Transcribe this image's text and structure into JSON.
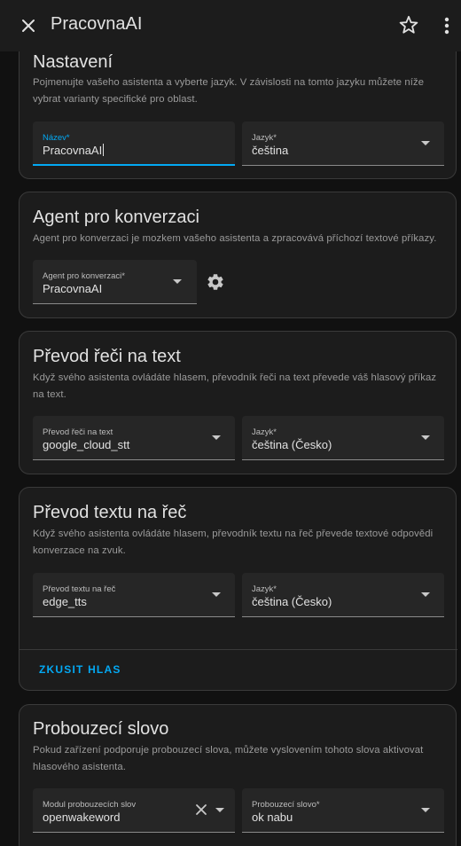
{
  "header": {
    "title": "PracovnaAI",
    "close_icon": "close-icon",
    "star_icon": "star-outline-icon",
    "more_icon": "more-vertical-icon"
  },
  "settings": {
    "title": "Nastavení",
    "description": "Pojmenujte vašeho asistenta a vyberte jazyk. V závislosti na tomto jazyku můžete níže vybrat varianty specifické pro oblast.",
    "name_label": "Název*",
    "name_value": "PracovnaAI",
    "language_label": "Jazyk*",
    "language_value": "čeština"
  },
  "conversation": {
    "title": "Agent pro konverzaci",
    "description": "Agent pro konverzaci je mozkem vašeho asistenta a zpracovává příchozí textové příkazy.",
    "agent_label": "Agent pro konverzaci*",
    "agent_value": "PracovnaAI"
  },
  "stt": {
    "title": "Převod řeči na text",
    "description": "Když svého asistenta ovládáte hlasem, převodník řeči na text převede váš hlasový příkaz na text.",
    "engine_label": "Převod řeči na text",
    "engine_value": "google_cloud_stt",
    "language_label": "Jazyk*",
    "language_value": "čeština (Česko)"
  },
  "tts": {
    "title": "Převod textu na řeč",
    "description": "Když svého asistenta ovládáte hlasem, převodník textu na řeč převede textové odpovědi konverzace na zvuk.",
    "engine_label": "Převod textu na řeč",
    "engine_value": "edge_tts",
    "language_label": "Jazyk*",
    "language_value": "čeština (Česko)",
    "try_voice": "ZKUSIT HLAS"
  },
  "wakeword": {
    "title": "Probouzecí slovo",
    "description": "Pokud zařízení podporuje probouzecí slova, můžete vyslovením tohoto slova aktivovat hlasového asistenta.",
    "module_label": "Modul probouzecích slov",
    "module_value": "openwakeword",
    "word_label": "Probouzecí slovo*",
    "word_value": "ok nabu"
  },
  "colors": {
    "accent": "#03a9f4",
    "background": "#111111",
    "card": "#1c1c1c"
  }
}
